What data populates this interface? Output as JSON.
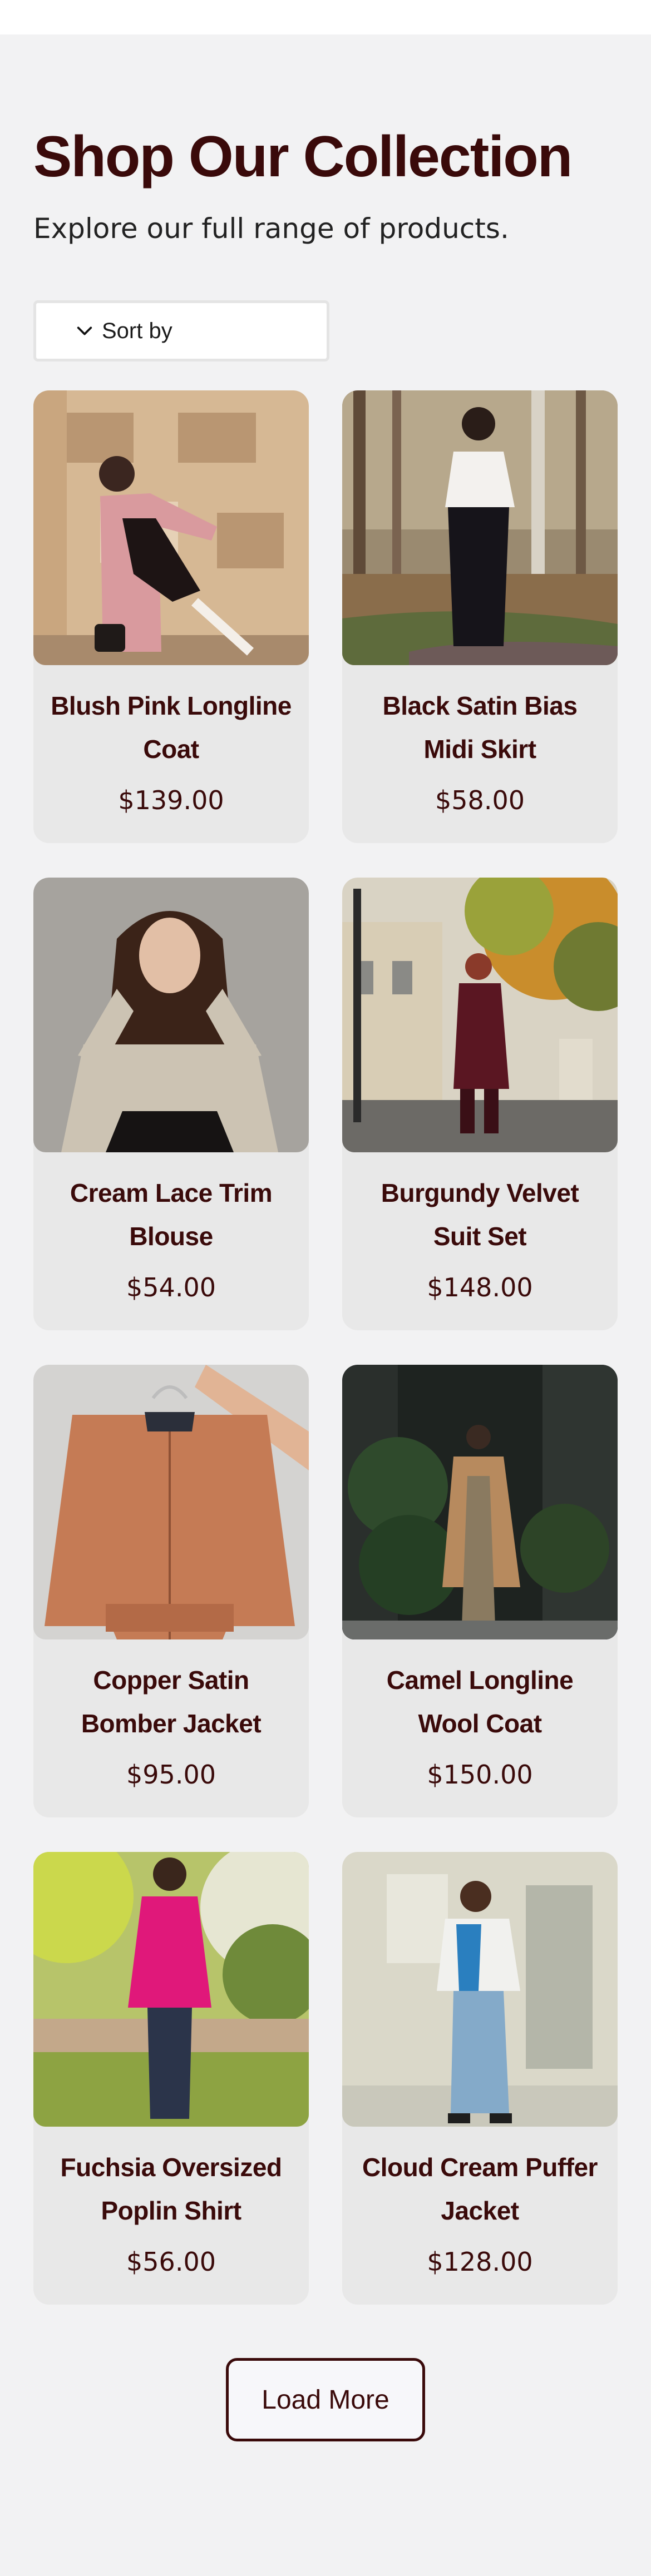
{
  "header": {
    "title": "Shop Our Collection",
    "subtitle": "Explore our full range of products."
  },
  "sort": {
    "label": "Sort by",
    "icon": "chevron-down-icon"
  },
  "products": [
    {
      "name": "Blush Pink Longline Coat",
      "price": "$139.00"
    },
    {
      "name": "Black Satin Bias Midi Skirt",
      "price": "$58.00"
    },
    {
      "name": "Cream Lace Trim Blouse",
      "price": "$54.00"
    },
    {
      "name": "Burgundy Velvet Suit Set",
      "price": "$148.00"
    },
    {
      "name": "Copper Satin Bomber Jacket",
      "price": "$95.00"
    },
    {
      "name": "Camel Longline Wool Coat",
      "price": "$150.00"
    },
    {
      "name": "Fuchsia Oversized Poplin Shirt",
      "price": "$56.00"
    },
    {
      "name": "Cloud Cream Puffer Jacket",
      "price": "$128.00"
    }
  ],
  "load_more": {
    "label": "Load More"
  },
  "colors": {
    "brand": "#3a0a0a",
    "card_bg": "#e8e8e8",
    "page_bg": "#f2f2f3"
  }
}
